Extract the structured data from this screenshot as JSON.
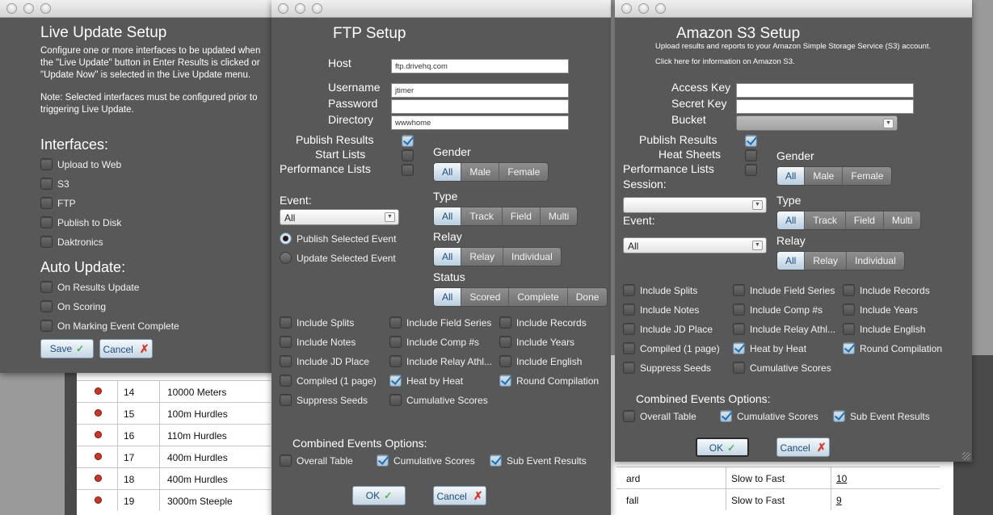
{
  "background": {
    "rows": [
      {
        "num": "14",
        "name": "10000 Meters"
      },
      {
        "num": "15",
        "name": "100m Hurdles"
      },
      {
        "num": "16",
        "name": "110m Hurdles"
      },
      {
        "num": "17",
        "name": "400m Hurdles"
      },
      {
        "num": "18",
        "name": "400m Hurdles"
      },
      {
        "num": "19",
        "name": "3000m Steeple"
      }
    ],
    "right_rows": [
      {
        "a": "ard",
        "b": "Slow to Fast",
        "c": "10"
      },
      {
        "a": "fall",
        "b": "Slow to Fast",
        "c": "9"
      }
    ]
  },
  "live": {
    "title": "Live Update Setup",
    "desc": [
      "Configure one or more interfaces to be updated when",
      "the \"Live Update\" button in Enter Results is clicked or",
      "\"Update Now\" is selected in the Live Update menu."
    ],
    "note": [
      "Note: Selected interfaces must be configured prior to",
      "triggering Live Update."
    ],
    "interfaces_heading": "Interfaces:",
    "interfaces": [
      "Upload to Web",
      "S3",
      "FTP",
      "Publish to Disk",
      "Daktronics"
    ],
    "auto_heading": "Auto Update:",
    "auto": [
      "On Results Update",
      "On Scoring",
      "On Marking Event Complete"
    ],
    "save": "Save",
    "cancel": "Cancel"
  },
  "ftp": {
    "title": "FTP Setup",
    "host_label": "Host",
    "host": "ftp.drivehq.com",
    "user_label": "Username",
    "user": "jtimer",
    "pass_label": "Password",
    "pass": "",
    "dir_label": "Directory",
    "dir": "wwwhome",
    "publish_results": "Publish Results",
    "start_lists": "Start Lists",
    "perf_lists": "Performance Lists",
    "gender_label": "Gender",
    "gender": [
      "All",
      "Male",
      "Female"
    ],
    "type_label": "Type",
    "type": [
      "All",
      "Track",
      "Field",
      "Multi"
    ],
    "relay_label": "Relay",
    "relay": [
      "All",
      "Relay",
      "Individual"
    ],
    "status_label": "Status",
    "status": [
      "All",
      "Scored",
      "Complete",
      "Done"
    ],
    "event_label": "Event:",
    "event": "All",
    "radio1": "Publish Selected Event",
    "radio2": "Update Selected Event",
    "opts": [
      "Include Splits",
      "Include Field Series",
      "Include Records",
      "Include Notes",
      "Include Comp #s",
      "Include Years",
      "Include JD Place",
      "Include Relay Athl...",
      "Include English",
      "Compiled (1 page)",
      "Heat by Heat",
      "Round Compilation",
      "Suppress Seeds",
      "Cumulative Scores"
    ],
    "combined_label": "Combined Events Options:",
    "combined": [
      "Overall Table",
      "Cumulative Scores",
      "Sub Event Results"
    ],
    "ok": "OK",
    "cancel": "Cancel"
  },
  "s3": {
    "title": "Amazon S3 Setup",
    "sub1": "Upload results and reports to your Amazon Simple Storage Service (S3) account.",
    "sub2": "Click here for information on Amazon S3.",
    "access_label": "Access Key",
    "secret_label": "Secret Key",
    "bucket_label": "Bucket",
    "publish_results": "Publish Results",
    "heat_sheets": "Heat Sheets",
    "perf_lists": "Performance Lists",
    "session_label": "Session:",
    "event_label": "Event:",
    "event": "All",
    "gender_label": "Gender",
    "gender": [
      "All",
      "Male",
      "Female"
    ],
    "type_label": "Type",
    "type": [
      "All",
      "Track",
      "Field",
      "Multi"
    ],
    "relay_label": "Relay",
    "relay": [
      "All",
      "Relay",
      "Individual"
    ],
    "opts": [
      "Include Splits",
      "Include Field Series",
      "Include Records",
      "Include Notes",
      "Include Comp #s",
      "Include Years",
      "Include JD Place",
      "Include Relay Athl...",
      "Include English",
      "Compiled (1 page)",
      "Heat by Heat",
      "Round Compilation",
      "Suppress Seeds",
      "Cumulative Scores"
    ],
    "combined_label": "Combined Events Options:",
    "combined": [
      "Overall Table",
      "Cumulative Scores",
      "Sub Event Results"
    ],
    "ok": "OK",
    "cancel": "Cancel"
  }
}
